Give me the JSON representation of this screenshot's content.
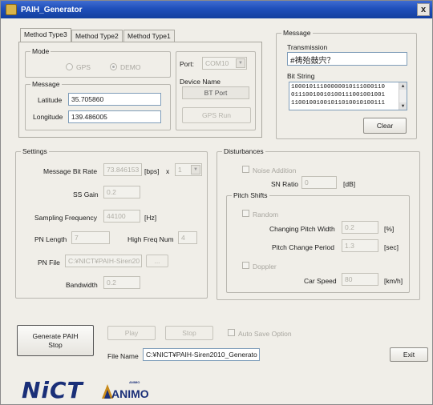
{
  "window": {
    "title": "PAIH_Generator",
    "close_glyph": "x"
  },
  "tabs": [
    {
      "label": "Method Type3",
      "active": true
    },
    {
      "label": "Method Type2",
      "active": false
    },
    {
      "label": "Method Type1",
      "active": false
    }
  ],
  "mode": {
    "legend": "Mode",
    "options": [
      {
        "label": "GPS",
        "selected": false
      },
      {
        "label": "DEMO",
        "selected": true
      }
    ]
  },
  "message_input": {
    "legend": "Message",
    "latitude_label": "Latitude",
    "latitude_value": "35.705860",
    "longitude_label": "Longitude",
    "longitude_value": "139.486005"
  },
  "port": {
    "label": "Port:",
    "value": "COM10"
  },
  "device": {
    "label": "Device Name",
    "value": "BT Port",
    "gps_run": "GPS Run"
  },
  "message_panel": {
    "legend": "Message",
    "transmission_label": "Transmission",
    "transmission_value": "#祷殆鼓宍？",
    "bitstring_label": "Bit String",
    "bitstring_lines": [
      "10001011100000010111000110",
      "01110010010100111001001001",
      "11001001001011010010100111"
    ],
    "clear": "Clear"
  },
  "settings": {
    "legend": "Settings",
    "bit_rate_label": "Message Bit Rate",
    "bit_rate_value": "73.846153",
    "bit_rate_unit": "[bps]",
    "multiply": "x",
    "multiplier_value": "1",
    "ss_gain_label": "SS Gain",
    "ss_gain_value": "0.2",
    "sampling_label": "Sampling Frequency",
    "sampling_value": "44100",
    "sampling_unit": "[Hz]",
    "pn_length_label": "PN Length",
    "pn_length_value": "7",
    "high_freq_label": "High Freq Num",
    "high_freq_value": "4",
    "pn_file_label": "PN File",
    "pn_file_value": "C:¥NICT¥PAIH-Siren20",
    "browse": "...",
    "bandwidth_label": "Bandwidth",
    "bandwidth_value": "0.2"
  },
  "disturbances": {
    "legend": "Disturbances",
    "noise_label": "Noise Addition",
    "sn_label": "SN Ratio",
    "sn_value": "0",
    "sn_unit": "[dB]",
    "pitch_legend": "Pitch Shifts",
    "random_label": "Random",
    "width_label": "Changing Pitch Width",
    "width_value": "0.2",
    "width_unit": "[%]",
    "period_label": "Pitch Change Period",
    "period_value": "1.3",
    "period_unit": "[sec]",
    "doppler_label": "Doppler",
    "speed_label": "Car Speed",
    "speed_value": "80",
    "speed_unit": "[km/h]"
  },
  "bottom": {
    "generate_line1": "Generate PAIH",
    "generate_line2": "Stop",
    "play": "Play",
    "stop": "Stop",
    "auto_save": "Auto Save Option",
    "file_name_label": "File Name",
    "file_name_value": "C:¥NICT¥PAIH-Siren2010_Generato",
    "exit": "Exit"
  },
  "logos": {
    "nict": "NiCT",
    "animo_small": "ANIMO",
    "animo": "ANIMO"
  }
}
